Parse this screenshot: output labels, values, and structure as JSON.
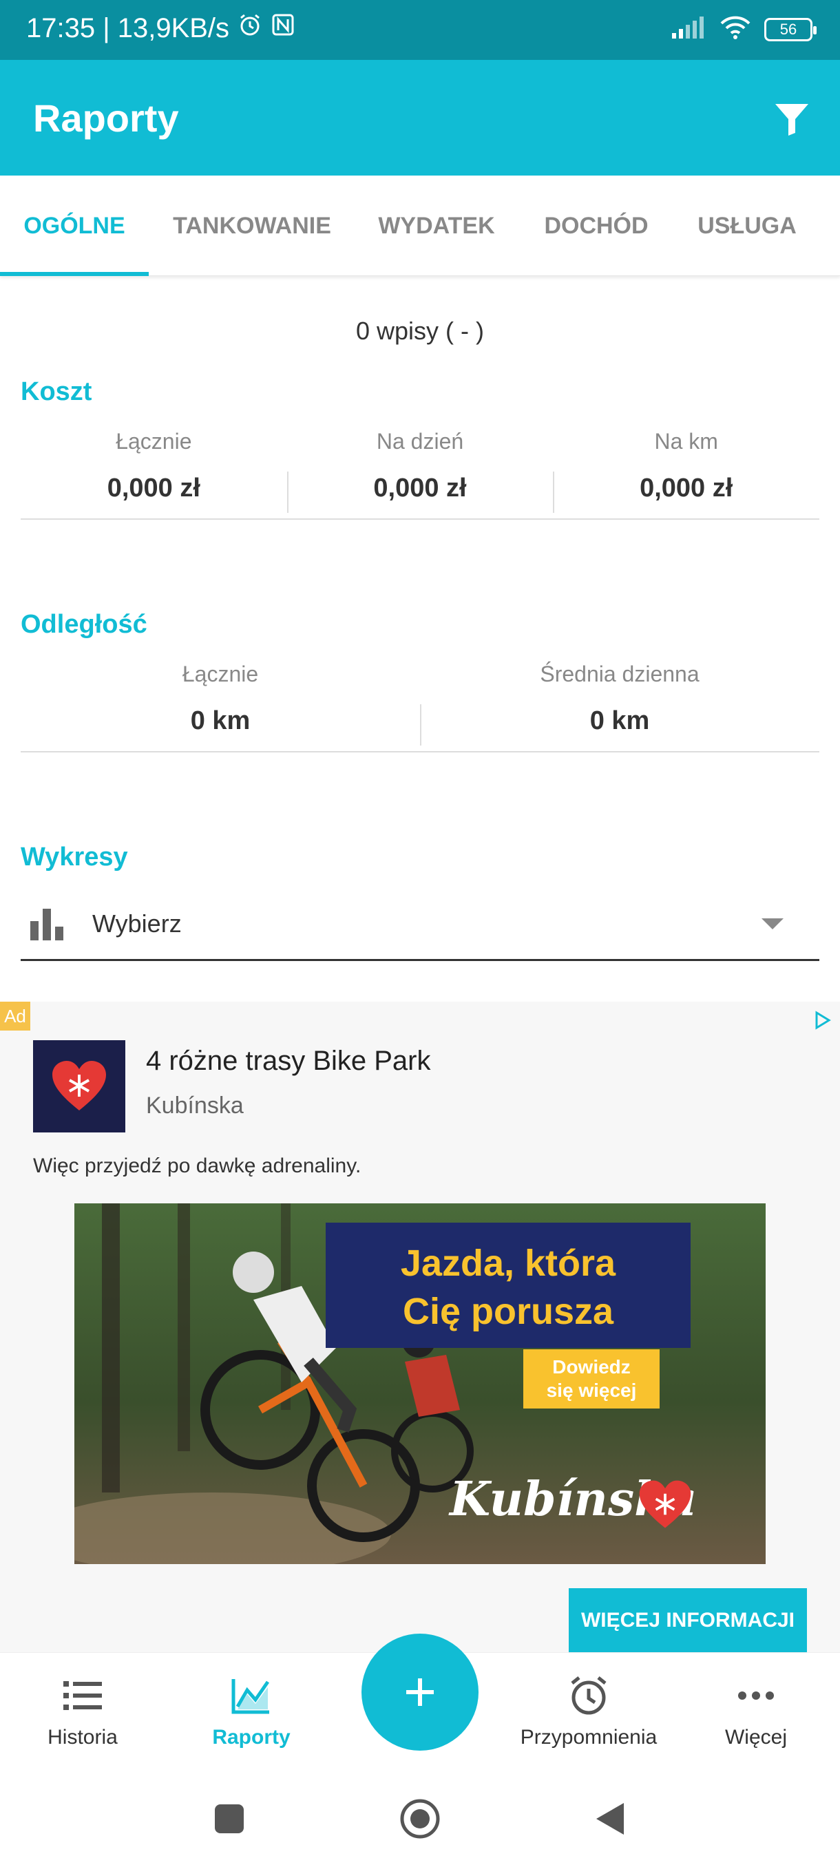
{
  "status_bar": {
    "time_info": "17:35 | 13,9KB/s",
    "battery": "56"
  },
  "app_bar": {
    "title": "Raporty"
  },
  "tabs": [
    {
      "label": "OGÓLNE",
      "active": true
    },
    {
      "label": "TANKOWANIE",
      "active": false
    },
    {
      "label": "WYDATEK",
      "active": false
    },
    {
      "label": "DOCHÓD",
      "active": false
    },
    {
      "label": "USŁUGA",
      "active": false
    }
  ],
  "entries_text": "0 wpisy ( - )",
  "cost": {
    "title": "Koszt",
    "stats": [
      {
        "label": "Łącznie",
        "value": "0,000 zł"
      },
      {
        "label": "Na dzień",
        "value": "0,000 zł"
      },
      {
        "label": "Na km",
        "value": "0,000 zł"
      }
    ]
  },
  "distance": {
    "title": "Odległość",
    "stats": [
      {
        "label": "Łącznie",
        "value": "0 km"
      },
      {
        "label": "Średnia dzienna",
        "value": "0 km"
      }
    ]
  },
  "charts": {
    "title": "Wykresy",
    "select_value": "Wybierz"
  },
  "ad": {
    "badge": "Ad",
    "title": "4 różne trasy Bike Park",
    "advertiser": "Kubínska",
    "description": "Więc przyjedź po dawkę adrenaliny.",
    "image_headline_1": "Jazda, która",
    "image_headline_2": "Cię porusza",
    "image_cta_1": "Dowiedz",
    "image_cta_2": "się więcej",
    "image_brand": "Kubínska",
    "button": "WIĘCEJ INFORMACJI"
  },
  "bottom_nav": {
    "items": [
      {
        "label": "Historia",
        "icon": "list-icon"
      },
      {
        "label": "Raporty",
        "icon": "chart-line-icon",
        "active": true
      },
      {
        "label": "Przypomnienia",
        "icon": "alarm-clock-icon"
      },
      {
        "label": "Więcej",
        "icon": "more-dots-icon"
      }
    ],
    "fab_icon": "plus-icon"
  },
  "colors": {
    "accent": "#11bcd4",
    "status_bar": "#0a8fa0",
    "ad_yellow": "#f9c22e",
    "ad_navy": "#1e2a6a"
  }
}
